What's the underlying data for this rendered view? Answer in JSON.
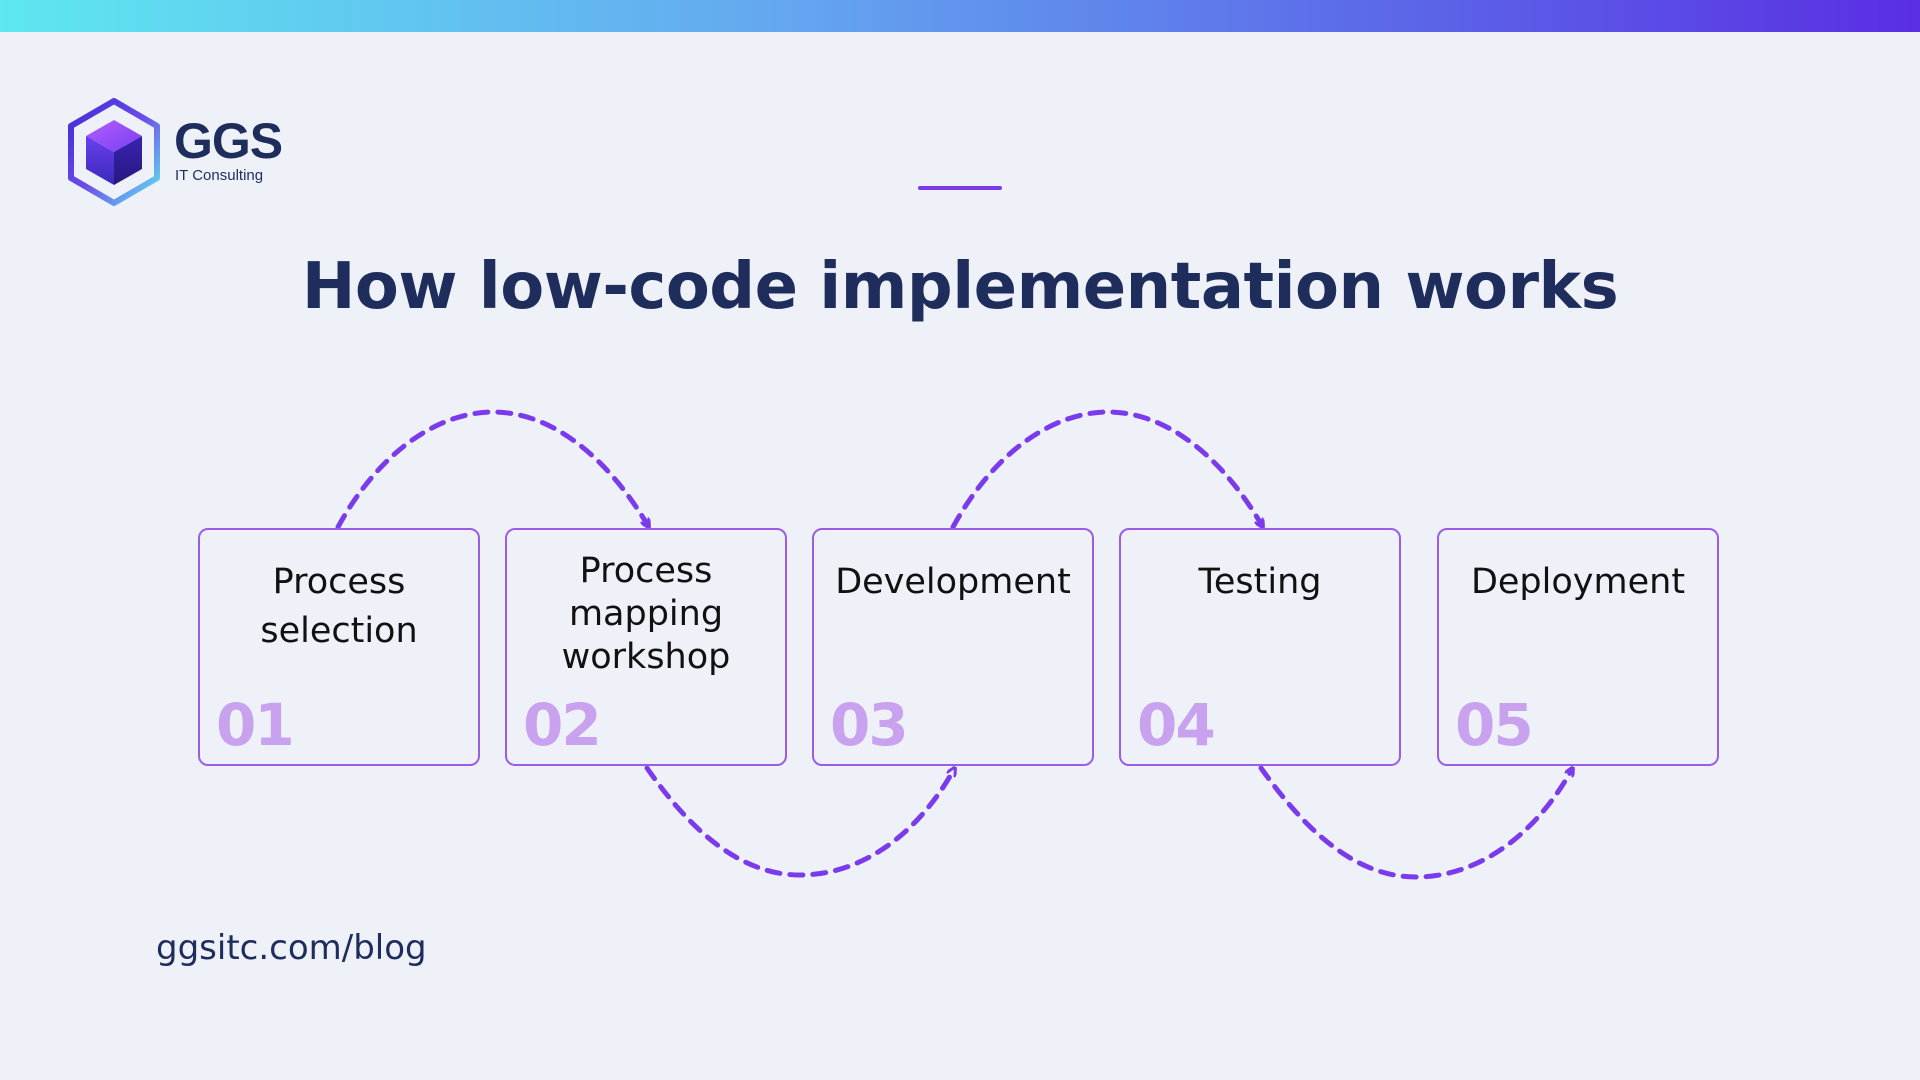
{
  "brand": {
    "name": "GGS",
    "tagline": "IT Consulting",
    "colors": {
      "primary_navy": "#1e2d5c",
      "accent_purple": "#7c3aed",
      "box_border": "#9b5de5",
      "step_number": "#c8a2ef"
    }
  },
  "title": "How low-code implementation works",
  "steps": [
    {
      "number": "01",
      "label": "Process selection"
    },
    {
      "number": "02",
      "label": "Process mapping workshop"
    },
    {
      "number": "03",
      "label": "Development"
    },
    {
      "number": "04",
      "label": "Testing"
    },
    {
      "number": "05",
      "label": "Deployment"
    }
  ],
  "footer": {
    "url": "ggsitc.com/blog"
  }
}
